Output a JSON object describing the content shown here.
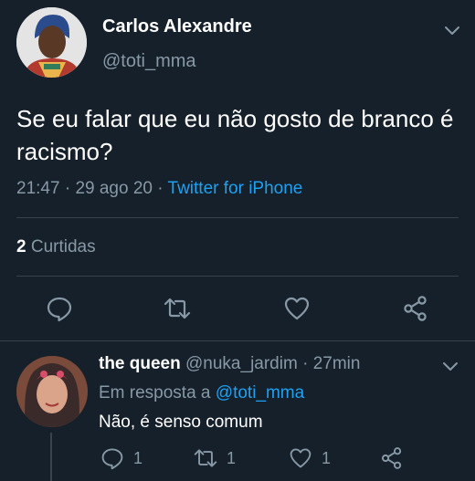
{
  "main_tweet": {
    "author_name": "Carlos Alexandre",
    "author_handle": "@toti_mma",
    "text": "Se eu falar que eu não gosto de branco é racismo?",
    "time": "21:47",
    "separator": "·",
    "date": "29 ago 20",
    "source": "Twitter for iPhone",
    "likes_count": "2",
    "likes_label": "Curtidas"
  },
  "reply": {
    "author_name": "the queen",
    "author_handle": "@nuka_jardim",
    "age": "27min",
    "reply_to_prefix": "Em resposta a",
    "reply_to_handle": "@toti_mma",
    "text": "Não, é senso comum",
    "reply_count": "1",
    "retweet_count": "1",
    "like_count": "1"
  },
  "icons": {
    "reply": "reply-icon",
    "retweet": "retweet-icon",
    "like": "heart-icon",
    "share": "share-icon",
    "more": "chevron-down-icon"
  },
  "colors": {
    "background": "#15202b",
    "text": "#ffffff",
    "secondary": "#8899a6",
    "accent": "#1da1f2",
    "divider": "#38444d"
  }
}
